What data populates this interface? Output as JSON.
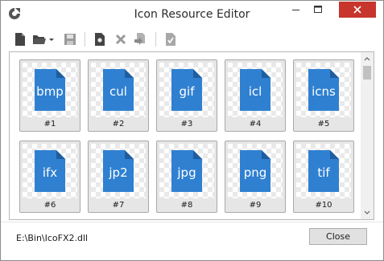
{
  "window": {
    "title": "Icon Resource Editor"
  },
  "toolbar": {
    "items": [
      "new-file-icon",
      "open-folder-icon",
      "dropdown-arrow-icon",
      "save-icon",
      "add-icon",
      "delete-icon",
      "extract-icon",
      "apply-icon"
    ]
  },
  "icons": [
    {
      "ext": "bmp",
      "label": "#1"
    },
    {
      "ext": "cul",
      "label": "#2"
    },
    {
      "ext": "gif",
      "label": "#3"
    },
    {
      "ext": "icl",
      "label": "#4"
    },
    {
      "ext": "icns",
      "label": "#5"
    },
    {
      "ext": "ifx",
      "label": "#6"
    },
    {
      "ext": "jp2",
      "label": "#7"
    },
    {
      "ext": "jpg",
      "label": "#8"
    },
    {
      "ext": "png",
      "label": "#9"
    },
    {
      "ext": "tif",
      "label": "#10"
    }
  ],
  "footer": {
    "path": "E:\\Bin\\IcoFX2.dll",
    "close_label": "Close"
  },
  "colors": {
    "file_icon": "#2f80d1",
    "file_fold": "#1f5e9e",
    "close_red": "#c7352c"
  }
}
